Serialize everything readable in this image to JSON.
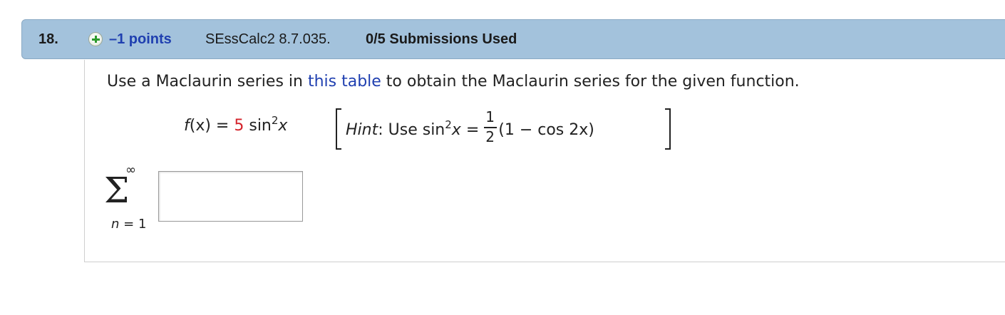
{
  "question": {
    "number": "18.",
    "points": "–1 points",
    "code": "SEssCalc2 8.7.035.",
    "submissions": "0/5 Submissions Used"
  },
  "prompt": {
    "before_link": "Use a Maclaurin series in ",
    "link_text": "this table",
    "after_link": " to obtain the Maclaurin series for the given function."
  },
  "function": {
    "name": "f",
    "arg": "(x)",
    "equals": " = ",
    "coefficient": "5",
    "func": " sin",
    "power": "2",
    "var": "x"
  },
  "hint": {
    "label": "Hint",
    "text": ": Use sin",
    "power": "2",
    "var": "x",
    "equals": " = ",
    "frac_num": "1",
    "frac_den": "2",
    "rest": "(1 − cos 2x)"
  },
  "summation": {
    "upper": "∞",
    "symbol": "Σ",
    "index_var": "n",
    "lower_rest": " = 1"
  },
  "answer_input": {
    "value": ""
  },
  "colors": {
    "header_bg": "#a3c2dc",
    "link": "#1f3fb0",
    "coefficient": "#d4222a"
  }
}
